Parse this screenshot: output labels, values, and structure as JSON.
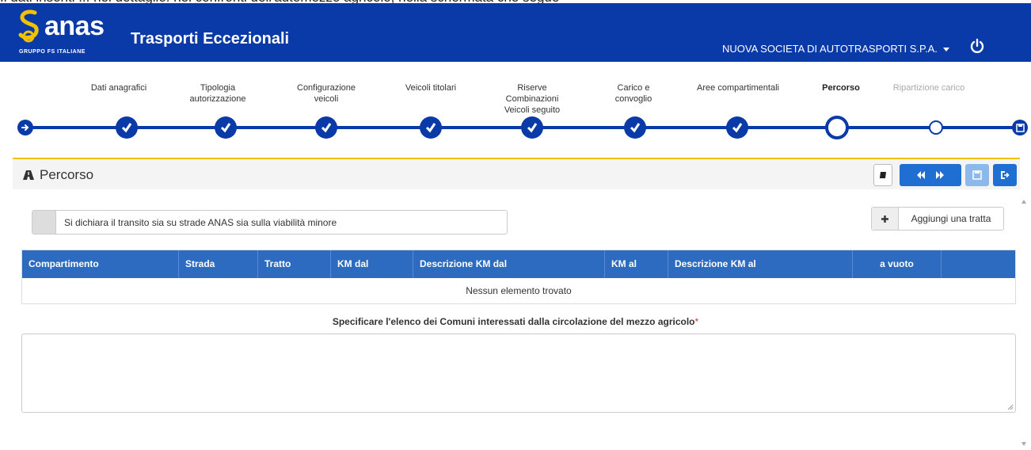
{
  "top_caption": "... dati inseriti ... ",
  "header": {
    "logo_word": "anas",
    "logo_sub": "GRUPPO FS ITALIANE",
    "app_title": "Trasporti Eccezionali",
    "company": "NUOVA SOCIETA DI AUTOTRASPORTI S.P.A."
  },
  "wizard": {
    "steps": [
      {
        "label": "Dati anagrafici",
        "state": "done"
      },
      {
        "label": "Tipologia autorizzazione",
        "state": "done"
      },
      {
        "label": "Configurazione veicoli",
        "state": "done"
      },
      {
        "label": "Veicoli titolari",
        "state": "done"
      },
      {
        "label": "Riserve Combinazioni Veicoli seguito",
        "state": "done"
      },
      {
        "label": "Carico e convoglio",
        "state": "done"
      },
      {
        "label": "Aree compartimentali",
        "state": "done"
      },
      {
        "label": "Percorso",
        "state": "current"
      },
      {
        "label": "Ripartizione carico",
        "state": "future"
      }
    ]
  },
  "panel": {
    "title": "Percorso",
    "icon": "road-icon"
  },
  "form": {
    "declare_text": "Si dichiara il transito sia su strade ANAS sia sulla viabilità minore",
    "add_button": "Aggiungi una tratta"
  },
  "table": {
    "columns": [
      "Compartimento",
      "Strada",
      "Tratto",
      "KM dal",
      "Descrizione KM dal",
      "KM al",
      "Descrizione KM al",
      "a vuoto",
      ""
    ],
    "empty_text": "Nessun elemento trovato"
  },
  "comuni": {
    "label": "Specificare l'elenco dei Comuni interessati dalla circolazione del mezzo agricolo",
    "required_mark": "*",
    "value": ""
  },
  "colors": {
    "header_bg": "#0a3aa8",
    "accent_yellow": "#f2c200",
    "table_head": "#2d6bc1",
    "button_blue": "#1e6fd1"
  }
}
